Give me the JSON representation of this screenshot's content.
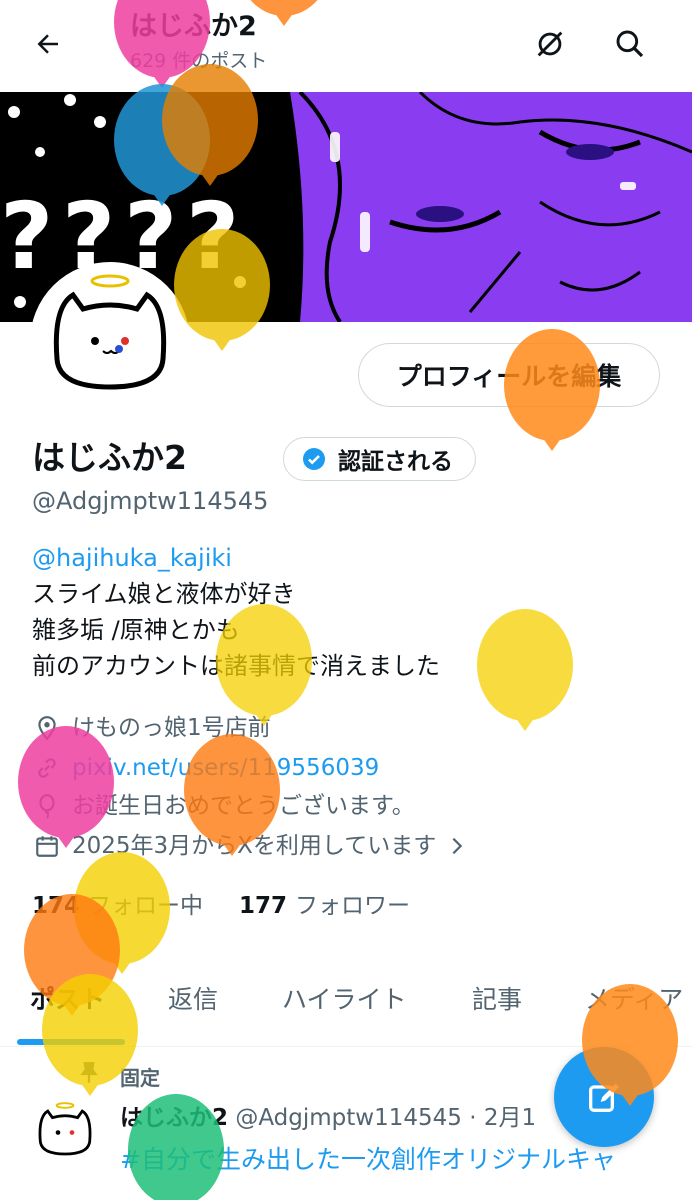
{
  "header": {
    "title": "はじふか2",
    "subtitle": "629 件のポスト"
  },
  "profile": {
    "edit_button": "プロフィールを編集",
    "display_name": "はじふか2",
    "verify_button": "認証される",
    "handle": "@Adgjmptw114545",
    "bio_mention": "@hajihuka_kajiki",
    "bio_lines": [
      "スライム娘と液体が好き",
      "雑多垢 /原神とかも",
      "前のアカウントは諸事情で消えました"
    ],
    "location": "けものっ娘1号店前",
    "website": "pixiv.net/users/119556039",
    "birthday": "お誕生日おめでとうございます。",
    "joined": "2025年3月からXを利用しています",
    "following_count": "174",
    "following_label": "フォロー中",
    "followers_count": "177",
    "followers_label": "フォロワー"
  },
  "tabs": [
    {
      "label": "ポスト",
      "active": true
    },
    {
      "label": "返信"
    },
    {
      "label": "ハイライト"
    },
    {
      "label": "記事"
    },
    {
      "label": "メディア"
    }
  ],
  "pinned_post": {
    "pinned_label": "固定",
    "author": "はじふか2",
    "meta": "@Adgjmptw114545 · 2月1",
    "text": "#自分で生み出した一次創作オリジナルキャ"
  },
  "colors": {
    "accent": "#1d9bf0",
    "text": "#0f1419",
    "secondary": "#536471",
    "banner_purple": "#8a3cf0"
  },
  "icons": [
    "back-arrow-icon",
    "hide-icon",
    "search-icon",
    "verified-badge-icon",
    "location-icon",
    "link-icon",
    "balloon-icon",
    "calendar-icon",
    "chevron-right-icon",
    "pin-icon",
    "compose-icon"
  ]
}
